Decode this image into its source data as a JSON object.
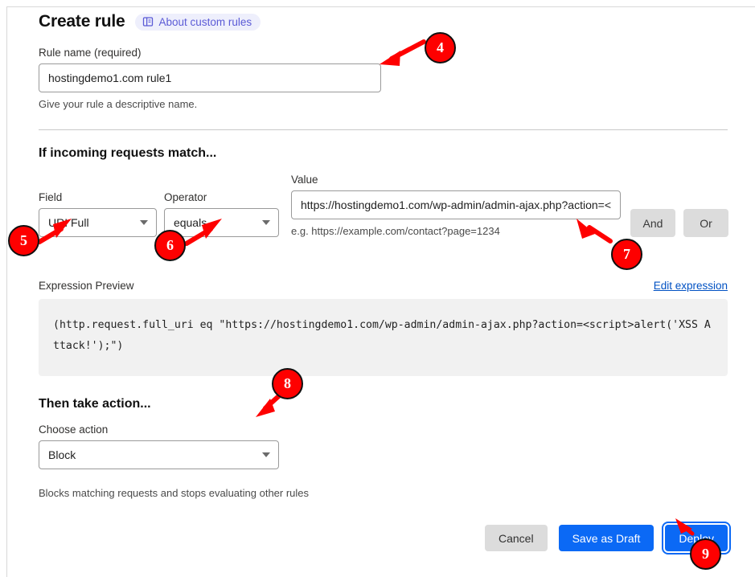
{
  "header": {
    "title": "Create rule",
    "about_pill": {
      "label": "About custom rules",
      "icon": "book-icon"
    }
  },
  "rule_name": {
    "label": "Rule name (required)",
    "value": "hostingdemo1.com rule1",
    "placeholder": "",
    "help": "Give your rule a descriptive name."
  },
  "match_section": {
    "title": "If incoming requests match...",
    "field": {
      "label": "Field",
      "value": "URI Full"
    },
    "operator": {
      "label": "Operator",
      "value": "equals"
    },
    "value": {
      "label": "Value",
      "value": "https://hostingdemo1.com/wp-admin/admin-ajax.php?action=<",
      "help": "e.g. https://example.com/contact?page=1234"
    },
    "and_button": "And",
    "or_button": "Or"
  },
  "expression_preview": {
    "label": "Expression Preview",
    "edit_link": "Edit expression",
    "expression": "(http.request.full_uri eq \"https://hostingdemo1.com/wp-admin/admin-ajax.php?action=<script>alert('XSS Attack!');\")"
  },
  "action_section": {
    "title": "Then take action...",
    "choose_label": "Choose action",
    "value": "Block",
    "help": "Blocks matching requests and stops evaluating other rules"
  },
  "footer": {
    "cancel": "Cancel",
    "save_draft": "Save as Draft",
    "deploy": "Deploy"
  },
  "annotations": {
    "markers": [
      {
        "number": "4"
      },
      {
        "number": "5"
      },
      {
        "number": "6"
      },
      {
        "number": "7"
      },
      {
        "number": "8"
      },
      {
        "number": "9"
      }
    ],
    "color": "#fe0000"
  }
}
